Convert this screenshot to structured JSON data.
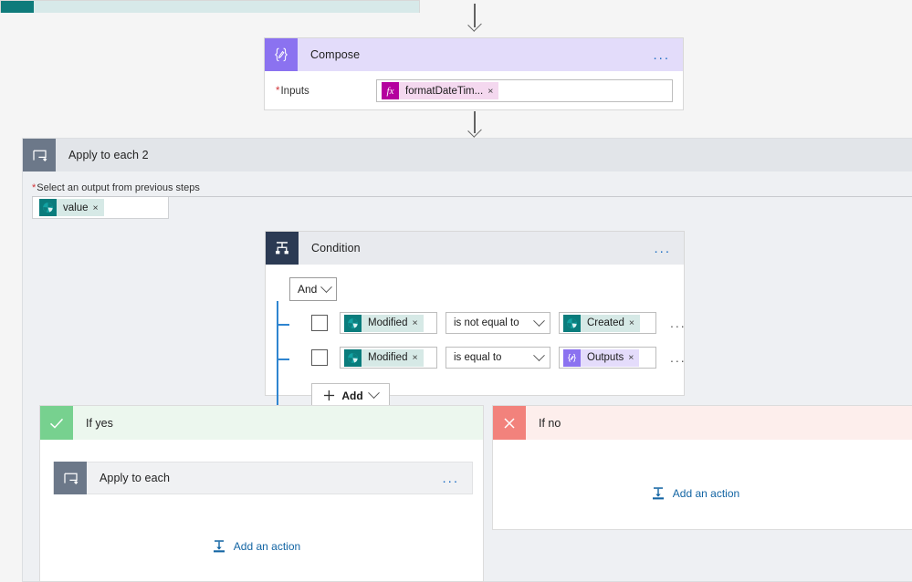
{
  "flow": {
    "top_partial_card": {
      "icon": "sharepoint-icon"
    },
    "compose": {
      "title": "Compose",
      "icon": "compose-braces-icon",
      "menu": "...",
      "input_label": "Inputs",
      "required_marker": "*",
      "input_token": {
        "label": "formatDateTim...",
        "icon": "fx-expression-icon",
        "remove": "×"
      }
    },
    "apply_to_each_2": {
      "title": "Apply to each 2",
      "icon": "loop-icon",
      "menu": "...",
      "field_label": "Select an output from previous steps",
      "required_marker": "*",
      "field_token": {
        "label": "value",
        "icon": "sharepoint-icon",
        "remove": "×"
      }
    },
    "condition": {
      "title": "Condition",
      "icon": "condition-branch-icon",
      "menu": "...",
      "logic_operator": "And",
      "rows": [
        {
          "left_token": {
            "label": "Modified",
            "icon": "sharepoint-icon",
            "remove": "×"
          },
          "operator": "is not equal to",
          "right_token": {
            "label": "Created",
            "icon": "sharepoint-icon",
            "remove": "×"
          },
          "menu": "..."
        },
        {
          "left_token": {
            "label": "Modified",
            "icon": "sharepoint-icon",
            "remove": "×"
          },
          "operator": "is equal to",
          "right_token": {
            "label": "Outputs",
            "icon": "compose-braces-icon",
            "remove": "×"
          },
          "menu": "..."
        }
      ],
      "add_button": {
        "label": "Add",
        "icon": "plus-icon"
      }
    },
    "if_yes": {
      "title": "If yes",
      "icon": "checkmark-icon",
      "nested_action": {
        "title": "Apply to each",
        "icon": "loop-icon",
        "menu": "..."
      },
      "add_action": {
        "label": "Add an action",
        "icon": "add-action-icon"
      }
    },
    "if_no": {
      "title": "If no",
      "icon": "cross-icon",
      "add_action": {
        "label": "Add an action",
        "icon": "add-action-icon"
      }
    }
  },
  "colors": {
    "canvas_bg": "#f5f5f5",
    "compose_accent": "#8b72f0",
    "sharepoint_accent": "#0a7c7c",
    "condition_accent": "#2b3a53",
    "loop_accent": "#6c7889",
    "if_yes_accent": "#77d18f",
    "if_no_accent": "#f2827c",
    "link_blue": "#1264a3",
    "required_red": "#d13438",
    "tree_blue": "#2f85d0"
  }
}
